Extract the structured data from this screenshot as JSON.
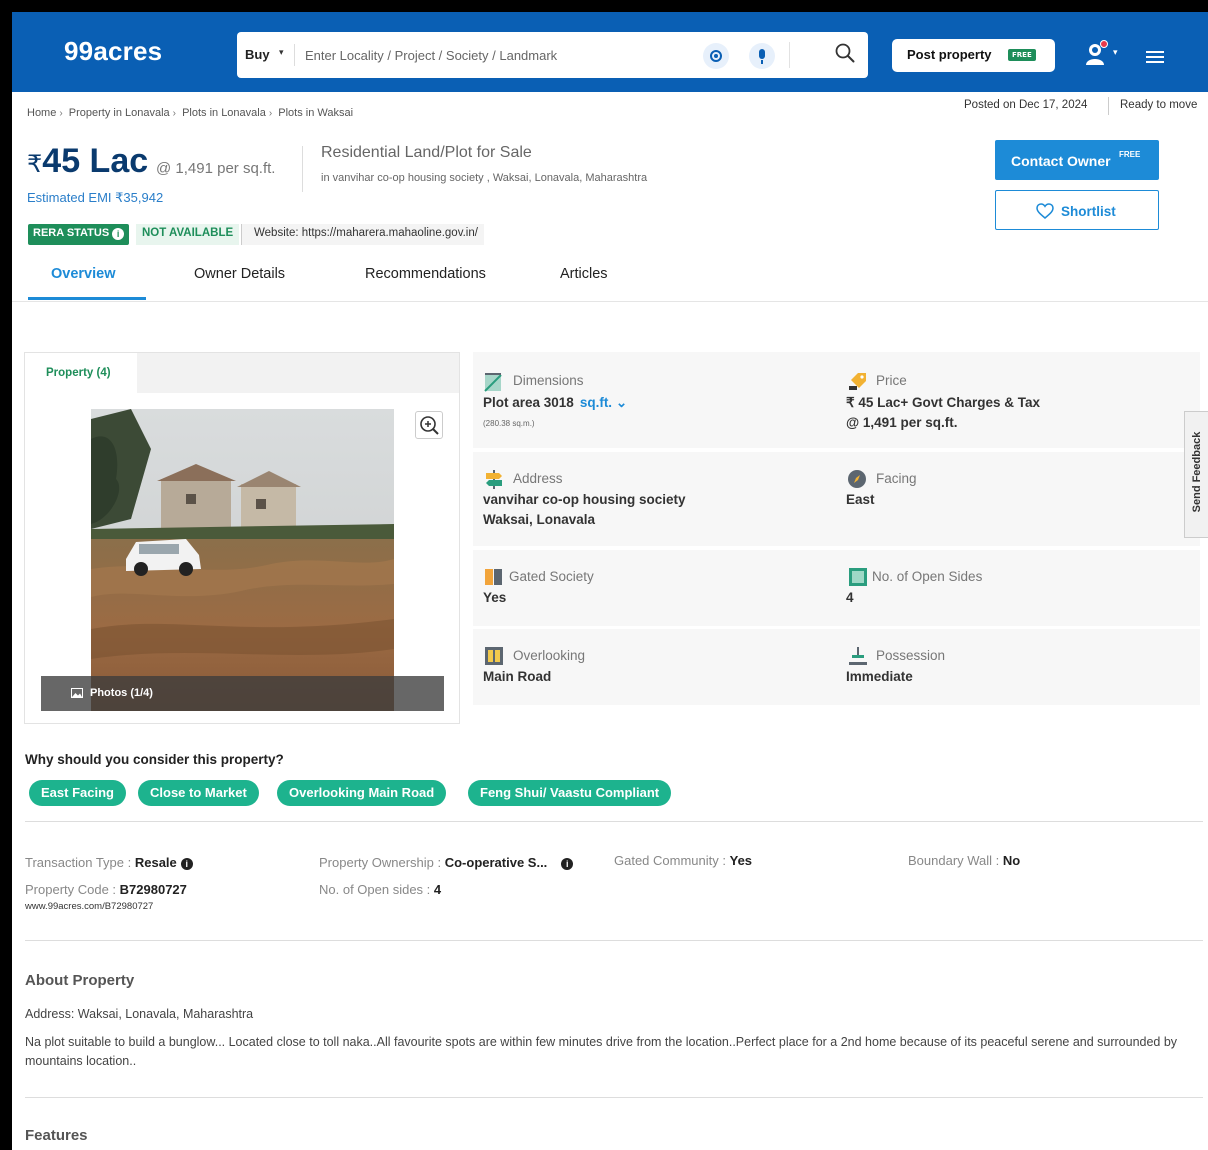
{
  "header": {
    "logo": "99acres",
    "search_type": "Buy",
    "search_placeholder": "Enter Locality / Project / Society / Landmark",
    "post_property_label": "Post property",
    "post_property_badge": "FREE",
    "brand_color": "#0a5fb4"
  },
  "breadcrumb": [
    "Home",
    "Property in Lonavala",
    "Plots in Lonavala",
    "Plots in Waksai"
  ],
  "posted_on": "Posted on Dec 17, 2024",
  "ready_status": "Ready to move",
  "listing": {
    "price_symbol": "₹",
    "price": "45 Lac",
    "per_sqft": "@ 1,491 per sq.ft.",
    "emi": "Estimated EMI ₹35,942",
    "type": "Residential Land/Plot for Sale",
    "location": "in vanvihar co-op housing society , Waksai, Lonavala, Maharashtra",
    "rera_label": "RERA STATUS",
    "rera_value": "NOT AVAILABLE",
    "rera_website": "Website: https://maharera.mahaoline.gov.in/"
  },
  "actions": {
    "contact_label": "Contact Owner",
    "contact_badge": "FREE",
    "shortlist_label": "Shortlist"
  },
  "tabs": [
    "Overview",
    "Owner Details",
    "Recommendations",
    "Articles"
  ],
  "gallery": {
    "tab_label": "Property (4)",
    "photos_label": "Photos (1/4)"
  },
  "details": {
    "dimensions_label": "Dimensions",
    "dimensions_value": "Plot area 3018",
    "dimensions_unit": "sq.ft.",
    "dimensions_sub": "(280.38 sq.m.)",
    "price_label": "Price",
    "price_value": "₹ 45 Lac+ Govt Charges & Tax",
    "price_sub": "@ 1,491 per sq.ft.",
    "address_label": "Address",
    "address_line1": "vanvihar co-op housing society",
    "address_line2": "Waksai, Lonavala",
    "facing_label": "Facing",
    "facing_value": "East",
    "gated_label": "Gated Society",
    "gated_value": "Yes",
    "open_sides_label": "No. of Open Sides",
    "open_sides_value": "4",
    "overlooking_label": "Overlooking",
    "overlooking_value": "Main Road",
    "possession_label": "Possession",
    "possession_value": "Immediate"
  },
  "feedback_label": "Send Feedback",
  "consider": {
    "title": "Why should you consider this property?",
    "chips": [
      "East Facing",
      "Close to Market",
      "Overlooking Main Road",
      "Feng Shui/ Vaastu Compliant"
    ]
  },
  "meta": {
    "transaction_label": "Transaction Type : ",
    "transaction_value": "Resale",
    "ownership_label": "Property Ownership : ",
    "ownership_value": "Co-operative S...",
    "gated_comm_label": "Gated Community : ",
    "gated_comm_value": "Yes",
    "boundary_label": "Boundary Wall : ",
    "boundary_value": "No",
    "code_label": "Property Code : ",
    "code_value": "B72980727",
    "open_sides_label": "No. of Open sides : ",
    "open_sides_value": "4",
    "code_url": "www.99acres.com/B72980727"
  },
  "about": {
    "title": "About Property",
    "address": "Address: Waksai, Lonavala, Maharashtra",
    "description": "Na plot suitable to build a bunglow... Located close to toll naka..All favourite spots are within few minutes drive from the location..Perfect place for a 2nd home because of its peaceful serene and surrounded by mountains location.."
  },
  "features_title": "Features"
}
